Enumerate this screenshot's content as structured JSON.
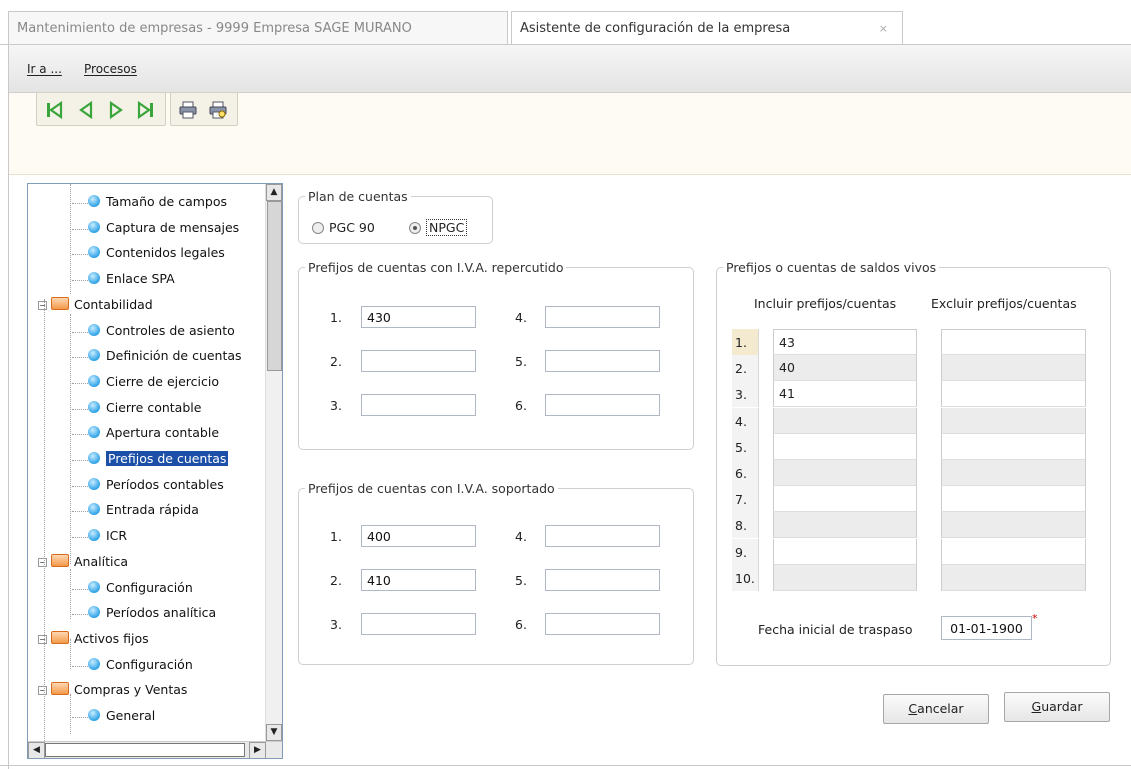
{
  "tabs": {
    "tab1": "Mantenimiento de empresas - 9999 Empresa SAGE MURANO",
    "tab2": "Asistente de configuración de la empresa",
    "close": "×"
  },
  "menu": {
    "ir_a": "Ir a ...",
    "procesos": "Procesos"
  },
  "toolbar_icons": [
    "first-record-icon",
    "previous-record-icon",
    "next-record-icon",
    "last-record-icon",
    "print-icon",
    "print-preview-icon"
  ],
  "tree": {
    "items": [
      {
        "label": "Tamaño de campos",
        "type": "leaf"
      },
      {
        "label": "Captura de mensajes",
        "type": "leaf"
      },
      {
        "label": "Contenidos legales",
        "type": "leaf"
      },
      {
        "label": "Enlace SPA",
        "type": "leaf"
      },
      {
        "label": "Contabilidad",
        "type": "folder"
      },
      {
        "label": "Controles de asiento",
        "type": "leaf"
      },
      {
        "label": "Definición de cuentas",
        "type": "leaf"
      },
      {
        "label": "Cierre de ejercicio",
        "type": "leaf"
      },
      {
        "label": "Cierre contable",
        "type": "leaf"
      },
      {
        "label": "Apertura contable",
        "type": "leaf"
      },
      {
        "label": "Prefijos de cuentas",
        "type": "leaf",
        "selected": true
      },
      {
        "label": "Períodos contables",
        "type": "leaf"
      },
      {
        "label": "Entrada rápida",
        "type": "leaf"
      },
      {
        "label": "ICR",
        "type": "leaf"
      },
      {
        "label": "Analítica",
        "type": "folder"
      },
      {
        "label": "Configuración",
        "type": "leaf"
      },
      {
        "label": "Períodos analítica",
        "type": "leaf"
      },
      {
        "label": "Activos fijos",
        "type": "folder"
      },
      {
        "label": "Configuración",
        "type": "leaf"
      },
      {
        "label": "Compras y Ventas",
        "type": "folder"
      },
      {
        "label": "General",
        "type": "leaf"
      }
    ]
  },
  "plan": {
    "legend": "Plan de cuentas",
    "opt1": "PGC 90",
    "opt2": "NPGC",
    "selected": "NPGC"
  },
  "repercutido": {
    "legend": "Prefijos de cuentas con I.V.A. repercutido",
    "labels": [
      "1.",
      "2.",
      "3.",
      "4.",
      "5.",
      "6."
    ],
    "values": [
      "430",
      "",
      "",
      "",
      "",
      ""
    ]
  },
  "soportado": {
    "legend": "Prefijos de cuentas con I.V.A. soportado",
    "labels": [
      "1.",
      "2.",
      "3.",
      "4.",
      "5.",
      "6."
    ],
    "values": [
      "400",
      "410",
      "",
      "",
      "",
      ""
    ]
  },
  "saldos": {
    "legend": "Prefijos o cuentas de saldos vivos",
    "col_incluir": "Incluir prefijos/cuentas",
    "col_excluir": "Excluir prefijos/cuentas",
    "rows": [
      "1.",
      "2.",
      "3.",
      "4.",
      "5.",
      "6.",
      "7.",
      "8.",
      "9.",
      "10."
    ],
    "incluir": [
      "43",
      "40",
      "41",
      "",
      "",
      "",
      "",
      "",
      "",
      ""
    ],
    "excluir": [
      "",
      "",
      "",
      "",
      "",
      "",
      "",
      "",
      "",
      ""
    ],
    "fecha_label": "Fecha inicial de traspaso",
    "fecha_value": "01-01-1900",
    "required_mark": "*"
  },
  "buttons": {
    "cancelar_u": "C",
    "cancelar_rest": "ancelar",
    "guardar_u": "G",
    "guardar_rest": "uardar"
  }
}
